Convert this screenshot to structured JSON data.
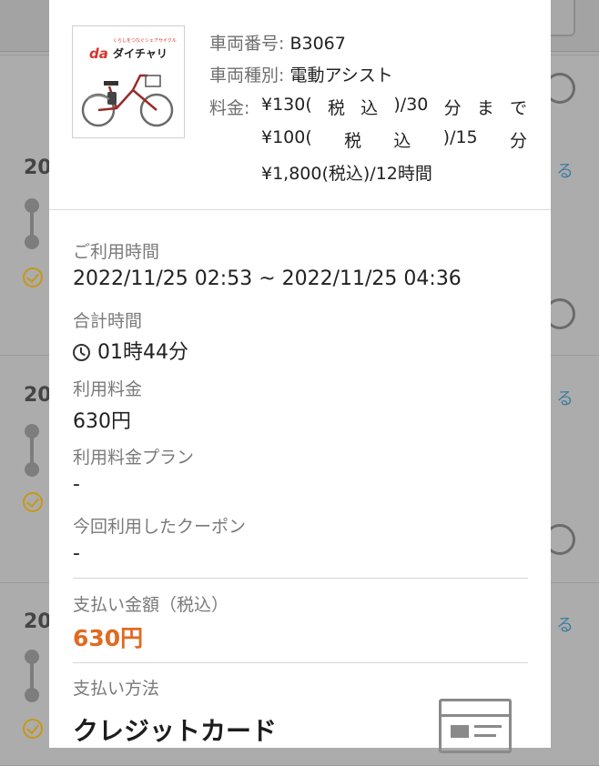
{
  "background": {
    "entries": [
      {
        "year_fragment": "20",
        "link_fragment": "る"
      },
      {
        "year_fragment": "20",
        "link_fragment": "る"
      },
      {
        "year_fragment": "20",
        "link_fragment": "る"
      }
    ]
  },
  "product": {
    "logo": {
      "brand_mark": "da",
      "name": "ダイチャリ",
      "tagline": "くらしをつなぐシェアサイクル"
    },
    "vehicle_number_label": "車両番号:",
    "vehicle_number": "B3067",
    "vehicle_type_label": "車両種別:",
    "vehicle_type": "電動アシスト",
    "price_label": "料金:",
    "price_lines": [
      [
        "¥130(",
        "税",
        "込",
        ")/30",
        "分",
        "ま",
        "で"
      ],
      [
        "¥100(",
        "税",
        "込",
        ")/15",
        "分"
      ],
      [
        "¥1,800(税込)/12時間"
      ]
    ]
  },
  "details": {
    "usage_time_label": "ご利用時間",
    "usage_time_value": "2022/11/25 02:53 ~ 2022/11/25 04:36",
    "total_time_label": "合計時間",
    "total_time_value": "01時44分",
    "fee_label": "利用料金",
    "fee_value": "630円",
    "plan_label": "利用料金プラン",
    "plan_value": "-",
    "coupon_label": "今回利用したクーポン",
    "coupon_value": "-",
    "payment_amount_label": "支払い金額（税込）",
    "payment_amount_value": "630円",
    "payment_method_label": "支払い方法",
    "payment_method_value": "クレジットカード",
    "accent_color": "#e06a22"
  }
}
